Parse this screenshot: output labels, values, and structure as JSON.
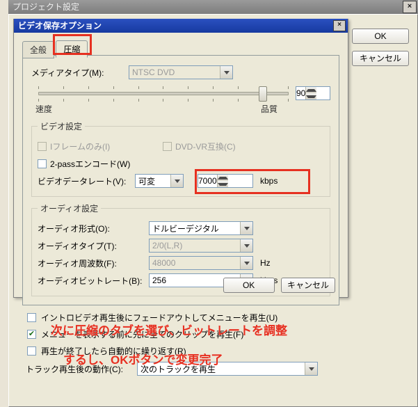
{
  "outer": {
    "title": "プロジェクト設定",
    "ok": "OK",
    "cancel": "キャンセル"
  },
  "inner": {
    "title": "ビデオ保存オプション",
    "tabs": {
      "general": "全般",
      "compress": "圧縮"
    },
    "mediaType": {
      "label": "メディアタイプ(M):",
      "value": "NTSC DVD"
    },
    "quality": {
      "value": "90",
      "left": "速度",
      "right": "品質"
    },
    "videoGroup": {
      "legend": "ビデオ設定",
      "iframe": "Iフレームのみ(I)",
      "dvdvr": "DVD-VR互換(C)",
      "twopass": "2-passエンコード(W)",
      "datarateLabel": "ビデオデータレート(V):",
      "datarateMode": "可変",
      "datarateValue": "7000",
      "datarateUnit": "kbps"
    },
    "audioGroup": {
      "legend": "オーディオ設定",
      "formatLabel": "オーディオ形式(O):",
      "formatValue": "ドルビーデジタル",
      "typeLabel": "オーディオタイプ(T):",
      "typeValue": "2/0(L,R)",
      "freqLabel": "オーディオ周波数(F):",
      "freqValue": "48000",
      "freqUnit": "Hz",
      "bitrateLabel": "オーディオビットレート(B):",
      "bitrateValue": "256",
      "bitrateUnit": "kbps"
    },
    "ok": "OK",
    "cancel": "キャンセル"
  },
  "lower": {
    "opt1": "イントロビデオ再生後にフェードアウトしてメニューを再生(U)",
    "opt2": "メニューを表示する前に先に全てのクリップを再生(F)",
    "opt3": "再生が終了したら自動的に繰り返す(R)",
    "trackLabel": "トラック再生後の動作(C):",
    "trackValue": "次のトラックを再生"
  },
  "annotations": {
    "line1": "次に圧縮のタブを選び、ビットレートを調整",
    "line2": "するし、OKボタンで変更完了"
  }
}
